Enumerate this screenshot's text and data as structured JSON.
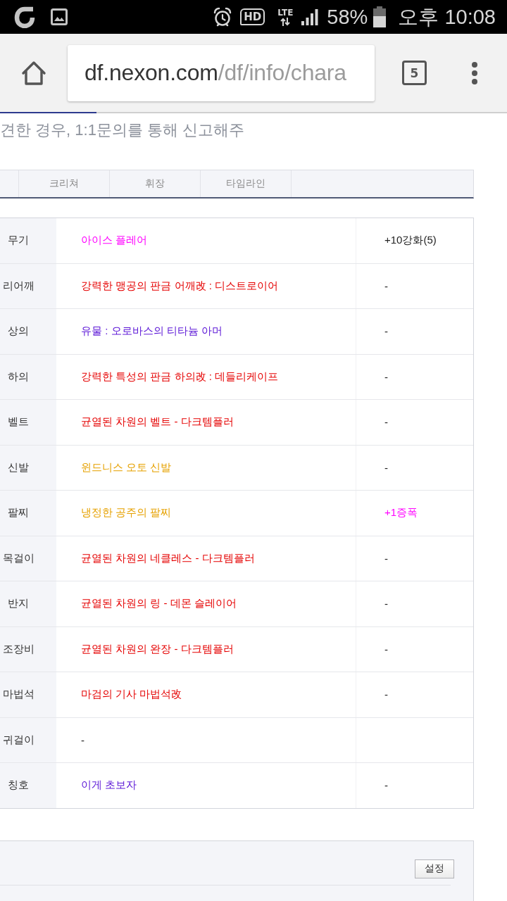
{
  "status_bar": {
    "hd_badge": "HD",
    "network": "LTE",
    "battery": "58%",
    "time": "오후 10:08"
  },
  "browser": {
    "url_host": "df.nexon.com",
    "url_path": "/df/info/chara",
    "tab_count": "5",
    "load_progress": {
      "level": 0.19
    }
  },
  "notice": "견한 경우, 1:1문의를 통해 신고해주",
  "tabs": [
    {
      "label": "크리쳐",
      "selected": false
    },
    {
      "label": "휘장",
      "selected": false
    },
    {
      "label": "타임라인",
      "selected": false
    }
  ],
  "equipment": [
    {
      "slot": "무기",
      "item": {
        "name": "아이스 플레어",
        "color": "#ff00ff"
      },
      "upgrade": {
        "text": "+10강화(5)",
        "color": "#222222"
      }
    },
    {
      "slot": "리어깨",
      "item": {
        "name": "강력한 맹공의 판금 어깨改 : 디스트로이어",
        "color": "#e50000"
      },
      "upgrade": {
        "text": "-",
        "color": "#222222"
      }
    },
    {
      "slot": "상의",
      "item": {
        "name": "유물 : 오로바스의 티타늄 아머",
        "color": "#5a14d6"
      },
      "upgrade": {
        "text": "-",
        "color": "#222222"
      }
    },
    {
      "slot": "하의",
      "item": {
        "name": "강력한 특성의 판금 하의改 : 데들리케이프",
        "color": "#e50000"
      },
      "upgrade": {
        "text": "-",
        "color": "#222222"
      }
    },
    {
      "slot": "벨트",
      "item": {
        "name": "균열된 차원의 벨트 - 다크템플러",
        "color": "#e50000"
      },
      "upgrade": {
        "text": "-",
        "color": "#222222"
      }
    },
    {
      "slot": "신발",
      "item": {
        "name": "윈드니스 오토 신발",
        "color": "#e6a100"
      },
      "upgrade": {
        "text": "-",
        "color": "#222222"
      }
    },
    {
      "slot": "팔찌",
      "item": {
        "name": "냉정한 공주의 팔찌",
        "color": "#e6a100"
      },
      "upgrade": {
        "text": "+1증폭",
        "color": "#ff00ff"
      }
    },
    {
      "slot": "목걸이",
      "item": {
        "name": "균열된 차원의 네클레스 - 다크템플러",
        "color": "#e50000"
      },
      "upgrade": {
        "text": "-",
        "color": "#222222"
      }
    },
    {
      "slot": "반지",
      "item": {
        "name": "균열된 차원의 링 - 데몬 슬레이어",
        "color": "#e50000"
      },
      "upgrade": {
        "text": "-",
        "color": "#222222"
      }
    },
    {
      "slot": "조장비",
      "item": {
        "name": "균열된 차원의 완장 - 다크템플러",
        "color": "#e50000"
      },
      "upgrade": {
        "text": "-",
        "color": "#222222"
      }
    },
    {
      "slot": "마법석",
      "item": {
        "name": "마검의 기사 마법석改",
        "color": "#e50000"
      },
      "upgrade": {
        "text": "-",
        "color": "#222222"
      }
    },
    {
      "slot": "귀걸이",
      "item": {
        "name": "-",
        "color": "#222222"
      }
    },
    {
      "slot": "칭호",
      "item": {
        "name": "이게 초보자",
        "color": "#5a14d6"
      },
      "upgrade": {
        "text": "-",
        "color": "#222222"
      }
    }
  ],
  "settings_panel": {
    "button": "설정"
  }
}
